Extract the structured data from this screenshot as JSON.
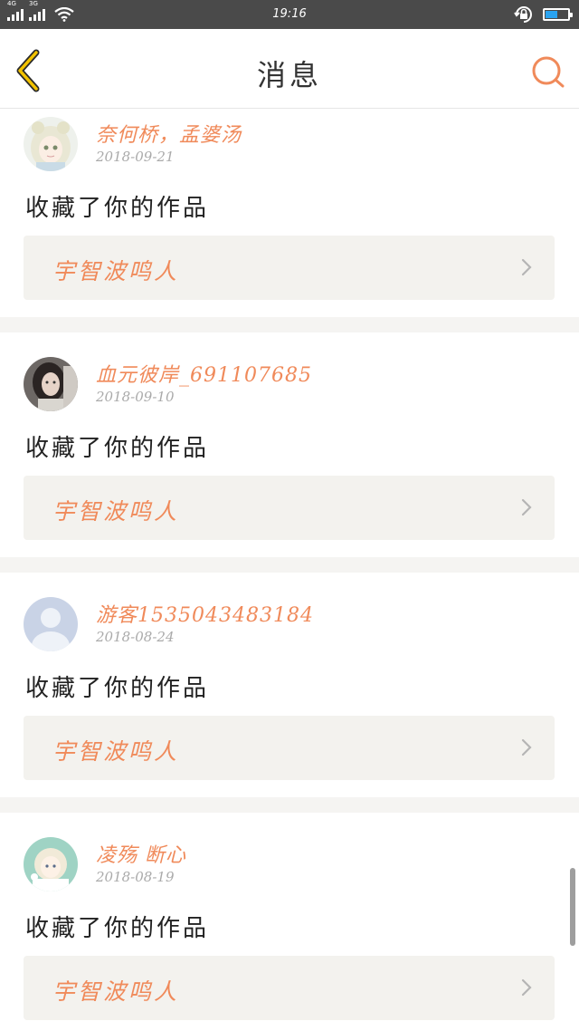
{
  "status_bar": {
    "network_1": "4G",
    "network_2": "3G",
    "time": "19:16",
    "battery_level": 0.55,
    "icons": [
      "signal-icon",
      "wifi-icon",
      "rotation-lock-icon",
      "battery-icon"
    ]
  },
  "nav": {
    "title": "消息",
    "back_icon": "chevron-left-icon",
    "search_icon": "search-icon",
    "accent_color": "#f08a5a",
    "back_color": "#f2c200"
  },
  "messages": [
    {
      "username": "奈何桥，孟婆汤",
      "date": "2018-09-21",
      "action": "收藏了你的作品",
      "work_title": "宇智波鸣人",
      "avatar": "anime-girl-avatar"
    },
    {
      "username": "血元彼岸_691107685",
      "date": "2018-09-10",
      "action": "收藏了你的作品",
      "work_title": "宇智波鸣人",
      "avatar": "photo-avatar"
    },
    {
      "username": "游客1535043483184",
      "date": "2018-08-24",
      "action": "收藏了你的作品",
      "work_title": "宇智波鸣人",
      "avatar": "default-user-avatar"
    },
    {
      "username": "凌殇 断心",
      "date": "2018-08-19",
      "action": "收藏了你的作品",
      "work_title": "宇智波鸣人",
      "avatar": "anime-boy-avatar"
    }
  ]
}
